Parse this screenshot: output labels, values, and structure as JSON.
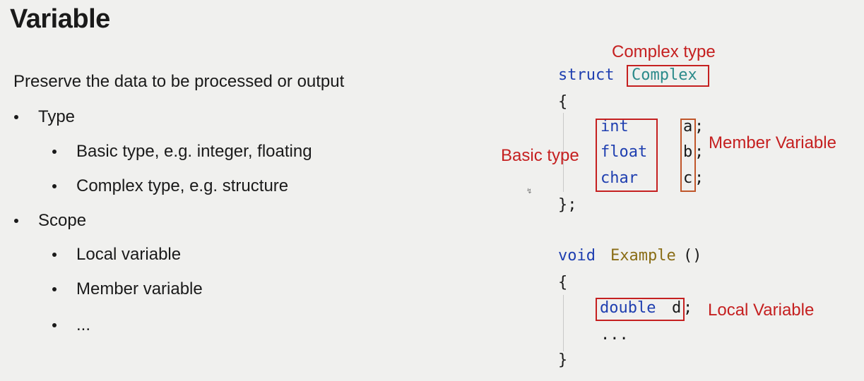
{
  "slide": {
    "title": "Variable",
    "intro": "Preserve the data to be processed or output",
    "bullets": [
      {
        "text": "Type",
        "level": 1
      },
      {
        "text": "Basic type, e.g. integer, floating",
        "level": 2
      },
      {
        "text": "Complex type, e.g. structure",
        "level": 2
      },
      {
        "text": "Scope",
        "level": 1
      },
      {
        "text": "Local variable",
        "level": 2
      },
      {
        "text": "Member variable",
        "level": 2
      },
      {
        "text": "...",
        "level": 2
      }
    ]
  },
  "code": {
    "struct_kw": "struct",
    "struct_name": "Complex",
    "open_brace_1": "{",
    "member_types": [
      "int",
      "float",
      "char"
    ],
    "member_names": [
      "a",
      "b",
      "c"
    ],
    "semicolon": ";",
    "close_brace_1": "};",
    "func_kw": "void",
    "func_name": "Example",
    "func_parens": "()",
    "open_brace_2": "{",
    "local_type": "double",
    "local_name": "d",
    "ellipsis": "...",
    "close_brace_2": "}"
  },
  "annotations": {
    "complex_type": "Complex type",
    "basic_type": "Basic type",
    "member_variable": "Member Variable",
    "local_variable": "Local Variable"
  },
  "colors": {
    "annotation_red": "#c52020",
    "keyword_blue": "#1f3fb0",
    "function_gold": "#8a6d16",
    "type_teal": "#2b8a8a"
  }
}
